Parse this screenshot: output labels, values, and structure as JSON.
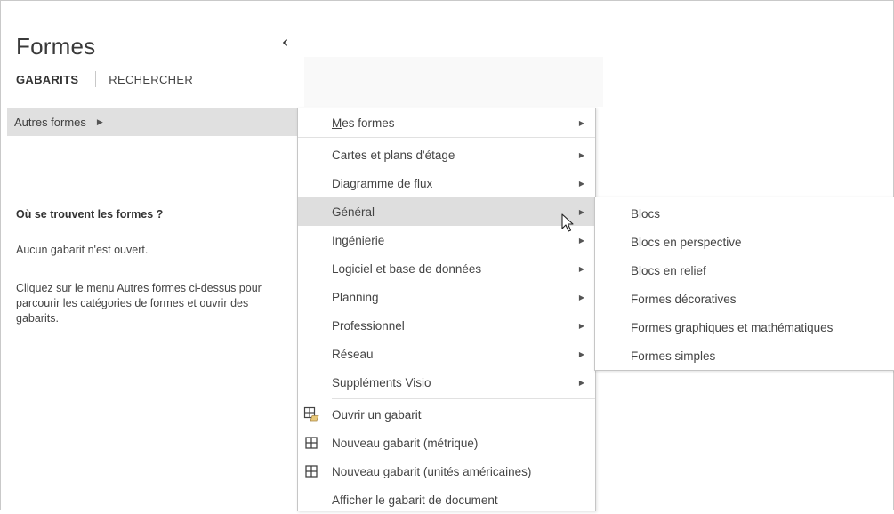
{
  "pane": {
    "title": "Formes",
    "tabs": [
      {
        "label": "GABARITS",
        "active": true
      },
      {
        "label": "RECHERCHER",
        "active": false
      }
    ],
    "more_shapes_label": "Autres formes",
    "help_title": "Où se trouvent les formes ?",
    "help_no_stencil": "Aucun gabarit n'est ouvert.",
    "help_instructions": "Cliquez sur le menu Autres formes ci-dessus pour parcourir les catégories de formes et ouvrir des gabarits."
  },
  "menu": {
    "items": [
      {
        "label": "Mes formes",
        "accelerator": "M",
        "rest": "es formes",
        "submenu": true
      },
      {
        "label": "Cartes et plans d'étage",
        "submenu": true
      },
      {
        "label": "Diagramme de flux",
        "submenu": true
      },
      {
        "label": "Général",
        "submenu": true,
        "highlighted": true
      },
      {
        "label": "Ingénierie",
        "submenu": true
      },
      {
        "label": "Logiciel et base de données",
        "submenu": true
      },
      {
        "label": "Planning",
        "submenu": true
      },
      {
        "label": "Professionnel",
        "submenu": true
      },
      {
        "label": "Réseau",
        "submenu": true
      },
      {
        "label": "Suppléments Visio",
        "submenu": true
      }
    ],
    "actions": [
      {
        "label": "Ouvrir un gabarit",
        "icon": "open-stencil-icon"
      },
      {
        "label": "Nouveau gabarit (métrique)",
        "icon": "new-stencil-icon"
      },
      {
        "label": "Nouveau gabarit (unités américaines)",
        "icon": "new-stencil-icon"
      },
      {
        "label": "Afficher le gabarit de document",
        "icon": ""
      }
    ]
  },
  "submenu": {
    "items": [
      {
        "label": "Blocs"
      },
      {
        "label": "Blocs en perspective"
      },
      {
        "label": "Blocs en relief"
      },
      {
        "label": "Formes décoratives"
      },
      {
        "label": "Formes graphiques et mathématiques"
      },
      {
        "label": "Formes simples"
      }
    ]
  },
  "colors": {
    "highlight": "#dedede",
    "selected_row": "#e0e0e0",
    "text": "#444444"
  }
}
